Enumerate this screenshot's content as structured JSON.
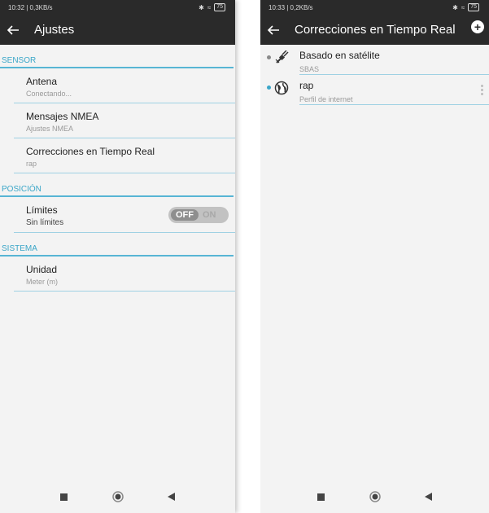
{
  "left": {
    "status": {
      "time_info": "10:32 | 0,3KB/s",
      "battery": "75"
    },
    "appbar": {
      "back_icon": "arrow-left-icon",
      "title": "Ajustes"
    },
    "sections": {
      "sensor": {
        "header": "SENSOR",
        "antena": {
          "title": "Antena",
          "summary": "Conectando..."
        },
        "nmea": {
          "title": "Mensajes NMEA",
          "summary": "Ajustes NMEA"
        },
        "corrections": {
          "title": "Correcciones en Tiempo Real",
          "summary": "rap"
        }
      },
      "posicion": {
        "header": "POSICIÓN",
        "limites": {
          "title": "Límites",
          "summary": "Sin límites",
          "toggle_off": "OFF",
          "toggle_on": "ON"
        }
      },
      "sistema": {
        "header": "SISTEMA",
        "unidad": {
          "title": "Unidad",
          "summary": "Meter (m)"
        }
      }
    }
  },
  "right": {
    "status": {
      "time_info": "10:33 | 0,2KB/s",
      "battery": "75"
    },
    "appbar": {
      "back_icon": "arrow-left-icon",
      "title": "Correcciones en Tiempo Real",
      "add_icon": "add-circle-icon"
    },
    "items": [
      {
        "title": "Basado en satélite",
        "subtitle": "SBAS",
        "icon": "satellite-icon",
        "dot_color": "#8a8a8a"
      },
      {
        "title": "rap",
        "subtitle": "Perfil de internet",
        "icon": "globe-icon",
        "dot_color": "#3aa6c8"
      }
    ]
  },
  "colors": {
    "accent": "#3aa6c8",
    "appbar": "#2a2a2a"
  }
}
